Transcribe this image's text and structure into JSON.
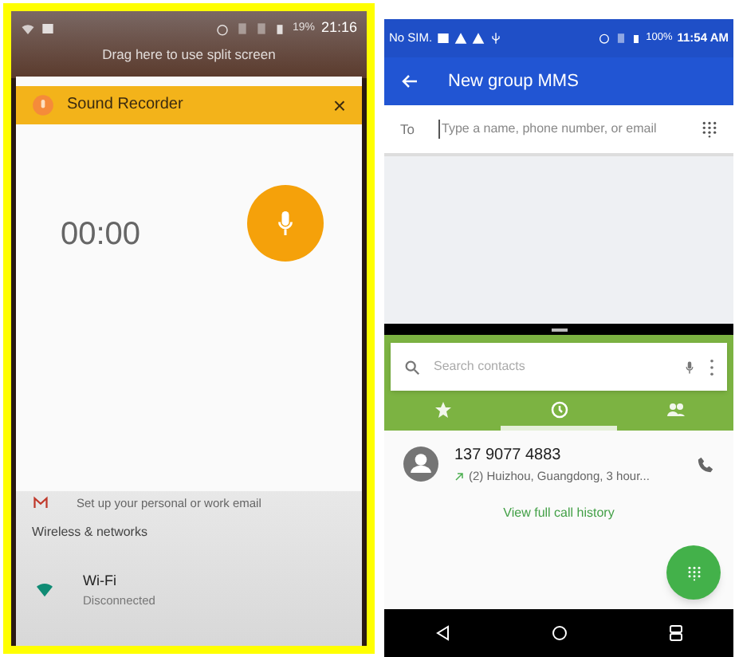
{
  "left_phone": {
    "status_bar": {
      "battery": "19%",
      "time": "21:16"
    },
    "split_hint": "Drag here to use split screen",
    "recorder": {
      "title": "Sound Recorder",
      "close": "×",
      "timer": "00:00"
    },
    "settings_behind": [
      {
        "kind": "item",
        "subtitle": "Set up your personal or work email"
      },
      {
        "kind": "header",
        "title": "Wireless & networks"
      },
      {
        "kind": "wifi",
        "title": "Wi-Fi",
        "subtitle": "Disconnected"
      }
    ]
  },
  "right_phone": {
    "status_bar": {
      "carrier": "No SIM.",
      "battery": "100%",
      "time": "11:54 AM"
    },
    "app_bar": {
      "title": "New group MMS"
    },
    "to_field": {
      "label": "To",
      "placeholder": "Type a name, phone number, or email"
    },
    "dialer": {
      "search": {
        "placeholder": "Search contacts"
      },
      "tabs": [
        {
          "kind": "favorites",
          "selected": false
        },
        {
          "kind": "recents",
          "selected": true
        },
        {
          "kind": "contacts",
          "selected": false
        }
      ],
      "calls": [
        {
          "number": "137 9077 4883",
          "detail": "(2) Huizhou, Guangdong, 3 hour..."
        }
      ],
      "history_link": "View full call history"
    }
  }
}
